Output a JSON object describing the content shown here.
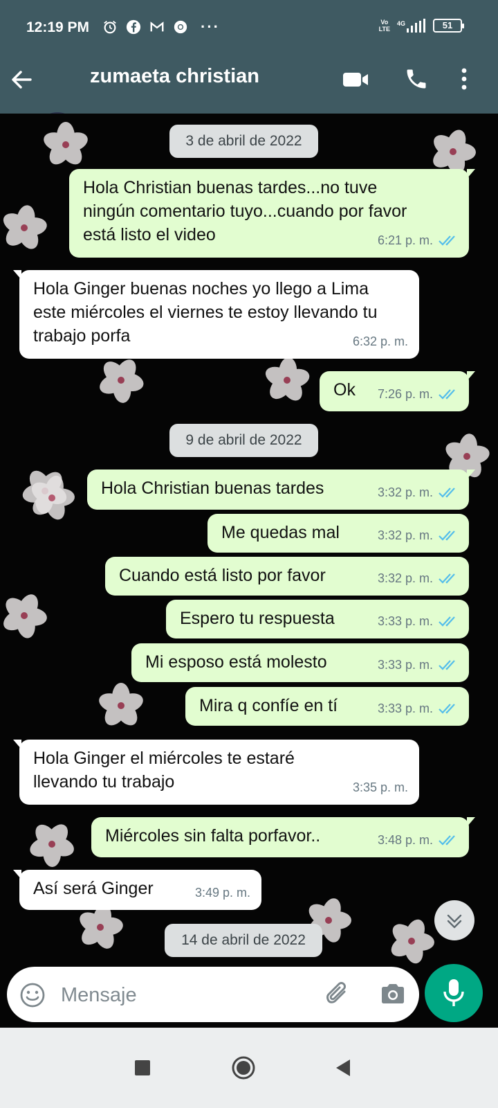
{
  "status_bar": {
    "time": "12:19 PM",
    "app_icons": [
      "alarm-icon",
      "facebook-icon",
      "gmail-icon",
      "chrome-icon"
    ],
    "more": "···",
    "network_top": "Vo",
    "network_bottom": "LTE",
    "signal": "4G",
    "battery": "51"
  },
  "header": {
    "contact_name": "zumaeta christian"
  },
  "chat": {
    "dates": [
      "3 de abril de 2022",
      "9 de abril de 2022",
      "14 de abril de 2022"
    ],
    "messages": [
      {
        "dir": "out",
        "text": "Hola Christian buenas tardes...no tuve ningún comentario tuyo...cuando por favor está listo el video",
        "time": "6:21 p. m.",
        "read": true
      },
      {
        "dir": "in",
        "text": "Hola Ginger buenas noches yo llego a Lima este miércoles el viernes te estoy llevando tu trabajo porfa",
        "time": "6:32 p. m."
      },
      {
        "dir": "out",
        "text": "Ok",
        "time": "7:26 p. m.",
        "read": true
      },
      {
        "dir": "out",
        "text": "Hola Christian buenas tardes",
        "time": "3:32 p. m.",
        "read": true
      },
      {
        "dir": "out",
        "text": "Me quedas mal",
        "time": "3:32 p. m.",
        "read": true
      },
      {
        "dir": "out",
        "text": "Cuando está listo por favor",
        "time": "3:32 p. m.",
        "read": true
      },
      {
        "dir": "out",
        "text": "Espero tu respuesta",
        "time": "3:33 p. m.",
        "read": true
      },
      {
        "dir": "out",
        "text": "Mi esposo está molesto",
        "time": "3:33 p. m.",
        "read": true
      },
      {
        "dir": "out",
        "text": "Mira q confíe en tí",
        "time": "3:33 p. m.",
        "read": true
      },
      {
        "dir": "in",
        "text": "Hola Ginger el miércoles te estaré llevando tu trabajo",
        "time": "3:35 p. m."
      },
      {
        "dir": "out",
        "text": "Miércoles sin falta porfavor..",
        "time": "3:48 p. m.",
        "read": true
      },
      {
        "dir": "in",
        "text": "Así será Ginger",
        "time": "3:49 p. m."
      }
    ]
  },
  "input": {
    "placeholder": "Mensaje"
  },
  "colors": {
    "header_bg": "#3f5a62",
    "outgoing_bubble": "#e2fdd0",
    "incoming_bubble": "#ffffff",
    "read_ticks": "#53bdeb",
    "mic_button": "#00a884"
  }
}
